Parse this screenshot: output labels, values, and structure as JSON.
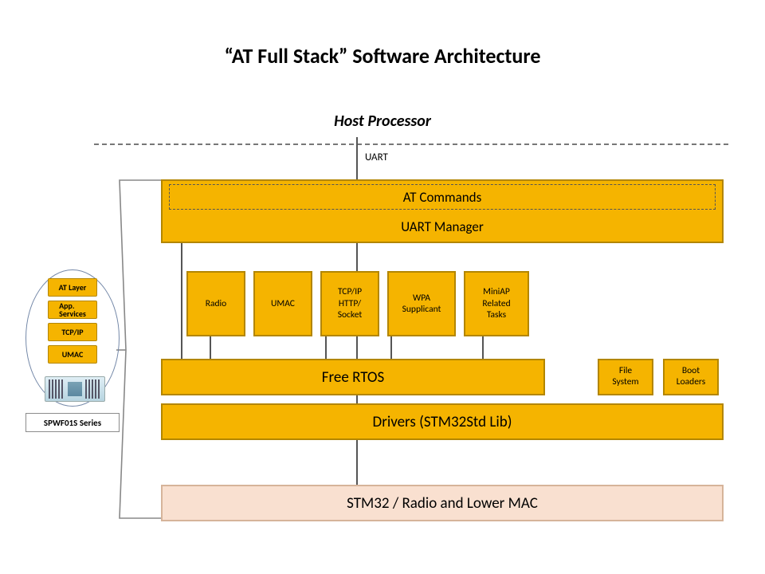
{
  "title": "“AT Full Stack” Software Architecture",
  "host_label": "Host Processor",
  "uart_label": "UART",
  "blocks": {
    "at_commands": "AT Commands",
    "uart_manager": "UART Manager",
    "free_rtos": "Free RTOS",
    "drivers": "Drivers (STM32Std Lib)",
    "hardware": "STM32 / Radio and Lower MAC",
    "file_system": "File\nSystem",
    "boot_loaders": "Boot\nLoaders"
  },
  "tasks": {
    "radio": "Radio",
    "umac": "UMAC",
    "tcpip": "TCP/IP\nHTTP/\nSocket",
    "wpa": "WPA\nSupplicant",
    "miniap": "MiniAP\nRelated\nTasks"
  },
  "legend": {
    "series": "SPWF01S Series",
    "items": {
      "at_layer": "AT Layer",
      "app_services": "App.\nServices",
      "tcpip": "TCP/IP",
      "umac": "UMAC"
    }
  },
  "colors": {
    "accent": "#f5b400",
    "hardware": "#f9e0d0"
  }
}
